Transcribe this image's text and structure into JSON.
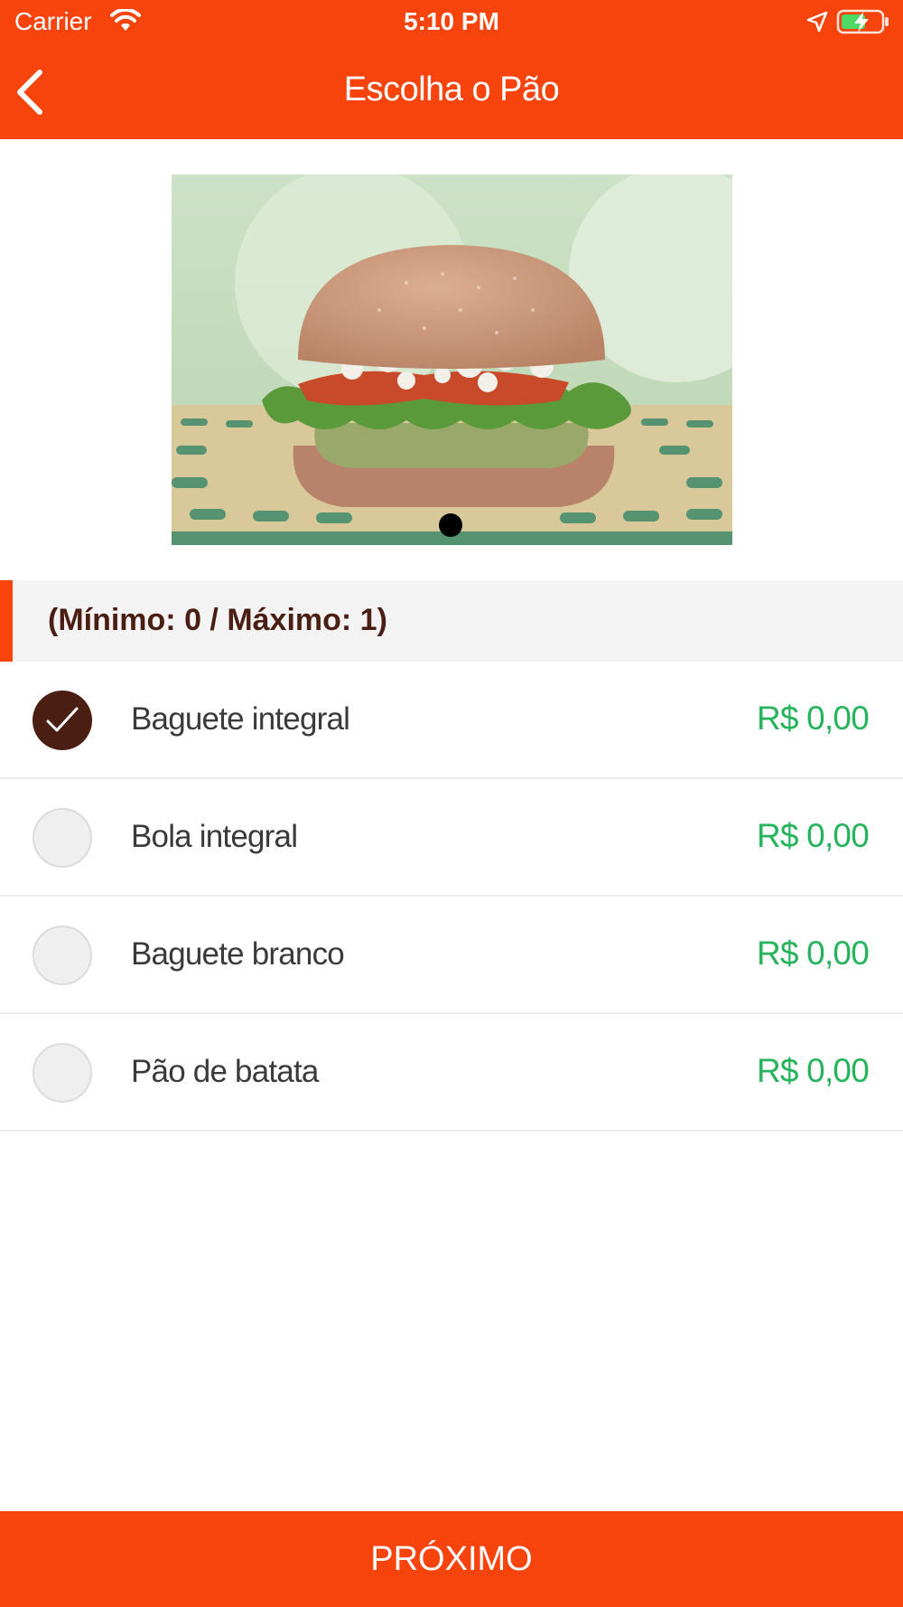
{
  "status_bar": {
    "carrier": "Carrier",
    "time": "5:10 PM",
    "icons": [
      "wifi-icon",
      "location-arrow-icon",
      "battery-charging-icon"
    ]
  },
  "nav": {
    "title": "Escolha o Pão",
    "back_icon": "chevron-left-icon"
  },
  "product_image": {
    "subject": "burger",
    "page_count": 1,
    "current_page": 1
  },
  "section": {
    "label": "(Mínimo: 0 / Máximo: 1)"
  },
  "options": [
    {
      "label": "Baguete integral",
      "price": "R$ 0,00",
      "selected": true
    },
    {
      "label": "Bola integral",
      "price": "R$ 0,00",
      "selected": false
    },
    {
      "label": "Baguete branco",
      "price": "R$ 0,00",
      "selected": false
    },
    {
      "label": "Pão de batata",
      "price": "R$ 0,00",
      "selected": false
    }
  ],
  "footer": {
    "next_label": "PRÓXIMO"
  },
  "colors": {
    "brand": "#f7430c",
    "price": "#25b35b",
    "selected": "#4a1e12",
    "section_bg": "#f3f3f3"
  }
}
